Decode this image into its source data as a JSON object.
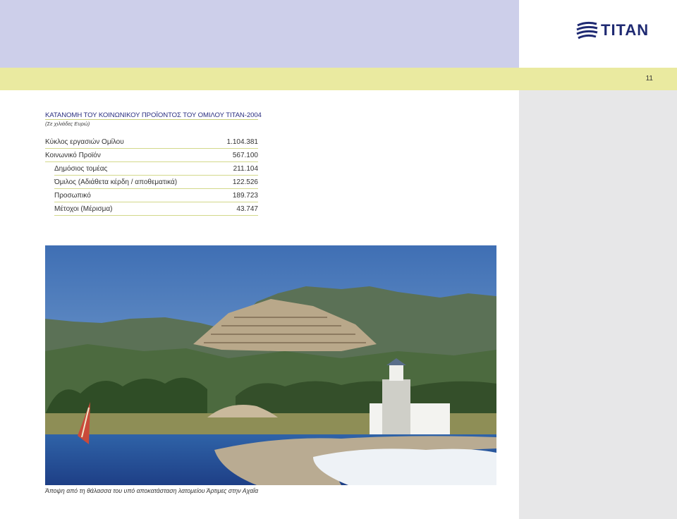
{
  "header": {
    "logo_text": "TITAN",
    "page_number": "11",
    "colors": {
      "top_band": "#cdcfea",
      "yellow_band": "#eaeaa0",
      "side_panel": "#e7e7e8",
      "title": "#2a2f80",
      "logo": "#1f2a72"
    }
  },
  "table": {
    "title": "ΚΑΤΑΝΟΜΗ ΤΟΥ ΚΟΙΝΩΝΙΚΟΥ ΠΡΟΪΟΝΤΟΣ ΤΟΥ ΟΜΙΛΟΥ TITAN-2004",
    "subtitle": "(Σε χιλιάδες Ευρώ)",
    "rows": [
      {
        "label": "Κύκλος εργασιών Ομίλου",
        "value": "1.104.381"
      },
      {
        "label": "Κοινωνικό Προϊόν",
        "value": "567.100"
      },
      {
        "label": "Δημόσιος τομέας",
        "value": "211.104"
      },
      {
        "label": "Όμιλος (Αδιάθετα κέρδη / αποθεματικά)",
        "value": "122.526"
      },
      {
        "label": "Προσωπικό",
        "value": "189.723"
      },
      {
        "label": "Μέτοχοι (Μέρισμα)",
        "value": "43.747"
      }
    ]
  },
  "photo": {
    "caption": "Άποψη από τη θάλασσα του υπό αποκατάσταση λατομείου Άρτιμες στην Αχαΐα"
  }
}
